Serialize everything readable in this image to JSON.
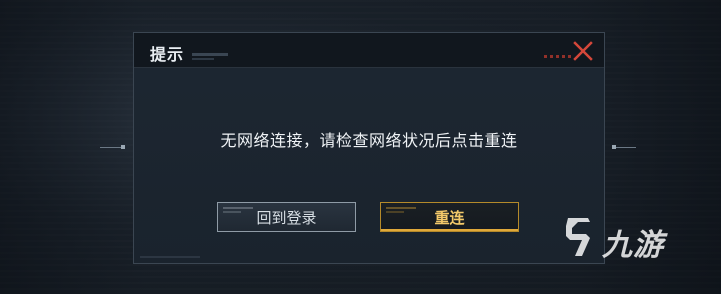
{
  "dialog": {
    "title": "提示",
    "message": "无网络连接，请检查网络状况后点击重连",
    "buttons": {
      "back_label": "回到登录",
      "retry_label": "重连"
    },
    "close_icon": "close-icon"
  },
  "colors": {
    "accent_gold": "#e0a93a",
    "close_red": "#d4473a",
    "dialog_bg": "#1d2732",
    "header_bg": "#11171e"
  },
  "watermark": {
    "text": "九游",
    "logo_icon": "9-logo-icon"
  }
}
